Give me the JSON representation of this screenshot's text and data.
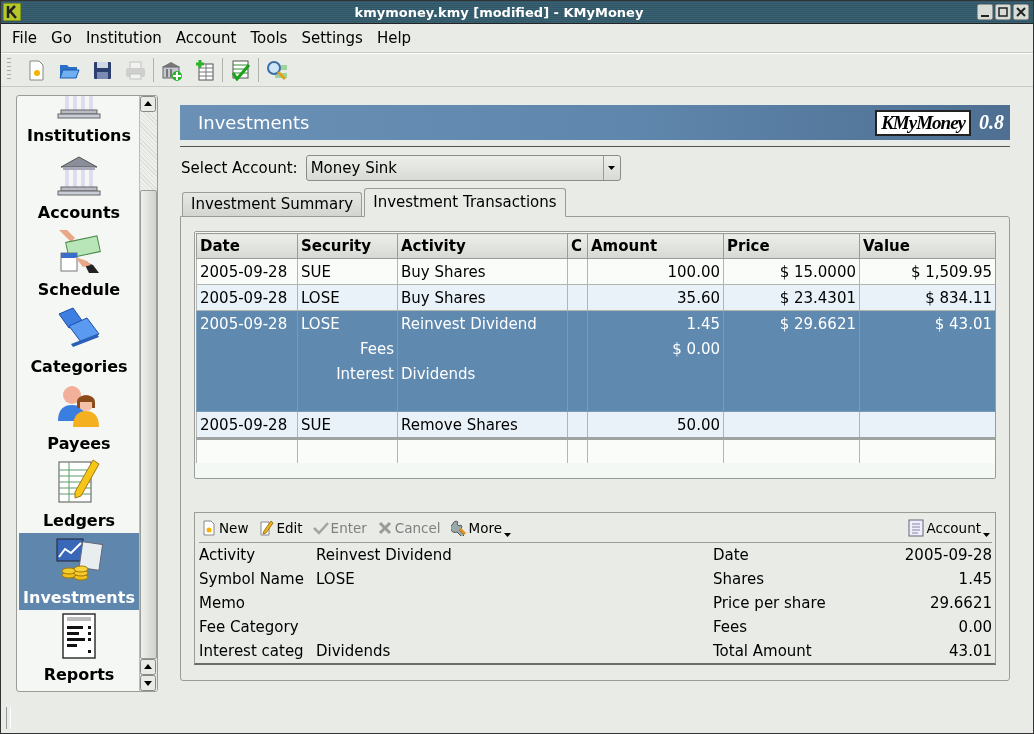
{
  "window": {
    "title": "kmymoney.kmy [modified] - KMyMoney"
  },
  "menu": [
    "File",
    "Go",
    "Institution",
    "Account",
    "Tools",
    "Settings",
    "Help"
  ],
  "toolbar": {
    "groups": [
      {
        "buttons": [
          {
            "kind": "new",
            "disabled": false
          },
          {
            "kind": "open",
            "disabled": false
          },
          {
            "kind": "save",
            "disabled": false
          },
          {
            "kind": "print",
            "disabled": true
          }
        ]
      },
      {
        "buttons": [
          {
            "kind": "bank-add",
            "disabled": false
          },
          {
            "kind": "account-add",
            "disabled": false
          }
        ]
      },
      {
        "buttons": [
          {
            "kind": "reconcile",
            "disabled": false
          }
        ]
      },
      {
        "buttons": [
          {
            "kind": "find",
            "disabled": false
          }
        ]
      }
    ]
  },
  "sidebar": {
    "items": [
      {
        "label": "Institutions",
        "kind": "institutions",
        "selected": false
      },
      {
        "label": "Accounts",
        "kind": "accounts",
        "selected": false
      },
      {
        "label": "Schedule",
        "kind": "schedule",
        "selected": false
      },
      {
        "label": "Categories",
        "kind": "categories",
        "selected": false
      },
      {
        "label": "Payees",
        "kind": "payees",
        "selected": false
      },
      {
        "label": "Ledgers",
        "kind": "ledgers",
        "selected": false
      },
      {
        "label": "Investments",
        "kind": "investments",
        "selected": true
      },
      {
        "label": "Reports",
        "kind": "reports",
        "selected": false
      }
    ]
  },
  "page": {
    "title": "Investments",
    "logo": "KMyMoney",
    "version": "0.8"
  },
  "account_select": {
    "label": "Select Account:",
    "value": "Money Sink"
  },
  "tabs": [
    {
      "label": "Investment Summary",
      "selected": false
    },
    {
      "label": "Investment Transactions",
      "selected": true
    }
  ],
  "ledger": {
    "columns": [
      "Date",
      "Security",
      "Activity",
      "C",
      "Amount",
      "Price",
      "Value"
    ],
    "rows": [
      {
        "date": "2005-09-28",
        "security": "SUE",
        "activity": "Buy Shares",
        "amount": "100.00",
        "price": "$ 15.0000",
        "value": "$ 1,509.95",
        "selected": false
      },
      {
        "date": "2005-09-28",
        "security": "LOSE",
        "activity": "Buy Shares",
        "amount": "35.60",
        "price": "$ 23.4301",
        "value": "$ 834.11",
        "selected": false
      },
      {
        "date": "2005-09-28",
        "security": "LOSE",
        "activity": "Reinvest Dividend",
        "amount": "1.45",
        "price": "$ 29.6621",
        "value": "$ 43.01",
        "selected": true,
        "splits": [
          {
            "label": "Fees",
            "amount": "$ 0.00"
          },
          {
            "label": "Interest",
            "activity": "Dividends"
          }
        ]
      },
      {
        "date": "2005-09-28",
        "security": "SUE",
        "activity": "Remove Shares",
        "amount": "50.00",
        "selected": false
      }
    ]
  },
  "form": {
    "actions": [
      {
        "label": "New",
        "kind": "new",
        "disabled": false
      },
      {
        "label": "Edit",
        "kind": "edit",
        "disabled": false
      },
      {
        "label": "Enter",
        "kind": "enter",
        "disabled": true
      },
      {
        "label": "Cancel",
        "kind": "cancel",
        "disabled": true
      },
      {
        "label": "More",
        "kind": "more",
        "disabled": false
      }
    ],
    "account_button": "Account",
    "left": [
      {
        "label": "Activity",
        "value": "Reinvest Dividend"
      },
      {
        "label": "Symbol Name",
        "value": "LOSE"
      },
      {
        "label": "Memo"
      },
      {
        "label": "Fee Category"
      },
      {
        "label": "Interest categ",
        "value": "Dividends"
      }
    ],
    "right": [
      {
        "label": "Date",
        "value": "2005-09-28"
      },
      {
        "label": "Shares",
        "value": "1.45"
      },
      {
        "label": "Price per share",
        "value": "29.6621"
      },
      {
        "label": "Fees",
        "value": "0.00"
      },
      {
        "label": "Total Amount",
        "value": "43.01"
      }
    ]
  }
}
